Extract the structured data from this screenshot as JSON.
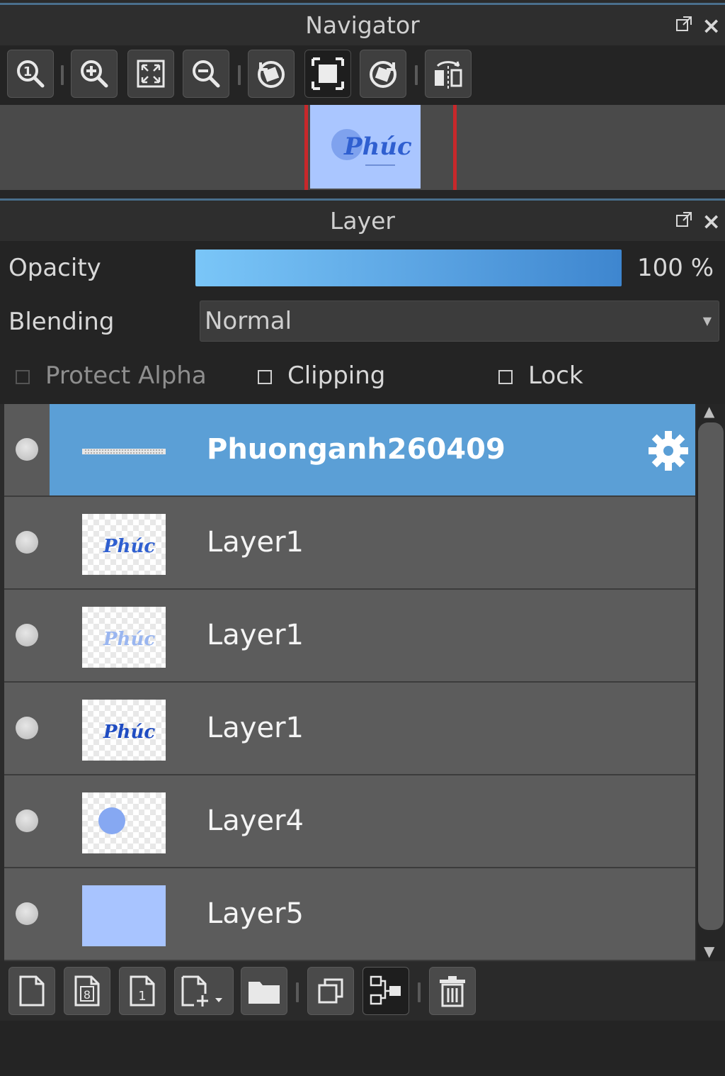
{
  "navigator": {
    "title": "Navigator",
    "window_buttons": {
      "popout": "popout-icon",
      "close": "×"
    },
    "toolbar": [
      {
        "icon": "zoom-actual-icon",
        "label": "1"
      },
      {
        "icon": "zoom-in-icon"
      },
      {
        "icon": "fit-view-icon"
      },
      {
        "icon": "zoom-out-icon"
      },
      {
        "icon": "rotate-left-icon"
      },
      {
        "icon": "reset-rotation-icon"
      },
      {
        "icon": "rotate-right-icon"
      },
      {
        "icon": "flip-horizontal-icon"
      }
    ],
    "preview_text": "Phúc"
  },
  "layer_panel": {
    "title": "Layer",
    "window_buttons": {
      "popout": "popout-icon",
      "close": "×"
    },
    "opacity": {
      "label": "Opacity",
      "value": 1.0,
      "display": "100 %"
    },
    "blending": {
      "label": "Blending",
      "value": "Normal"
    },
    "checkboxes": [
      {
        "label": "Protect Alpha",
        "checked": false,
        "enabled": false
      },
      {
        "label": "Clipping",
        "checked": false,
        "enabled": true
      },
      {
        "label": "Lock",
        "checked": false,
        "enabled": true
      }
    ],
    "layers": [
      {
        "name": "Phuonganh260409",
        "selected": true,
        "thumb": "text-strip",
        "settings_icon": "gear-icon"
      },
      {
        "name": "Layer1",
        "selected": false,
        "thumb": "logo-dark"
      },
      {
        "name": "Layer1",
        "selected": false,
        "thumb": "logo-light"
      },
      {
        "name": "Layer1",
        "selected": false,
        "thumb": "logo-bold"
      },
      {
        "name": "Layer4",
        "selected": false,
        "thumb": "circle"
      },
      {
        "name": "Layer5",
        "selected": false,
        "thumb": "blue-fill"
      }
    ],
    "thumb_text": "Phúc",
    "bottom_toolbar": [
      "new-layer-icon",
      "new-8bit-layer-icon",
      "new-1bit-layer-icon",
      "add-layer-menu-icon",
      "new-folder-icon",
      "duplicate-layer-icon",
      "merge-down-icon",
      "delete-layer-icon"
    ]
  },
  "colors": {
    "selection": "#5b9fd6",
    "opacity_start": "#7ac6f8",
    "opacity_end": "#3e86cf",
    "frame": "#c8282b",
    "logo_text": "#2f5fd0"
  }
}
